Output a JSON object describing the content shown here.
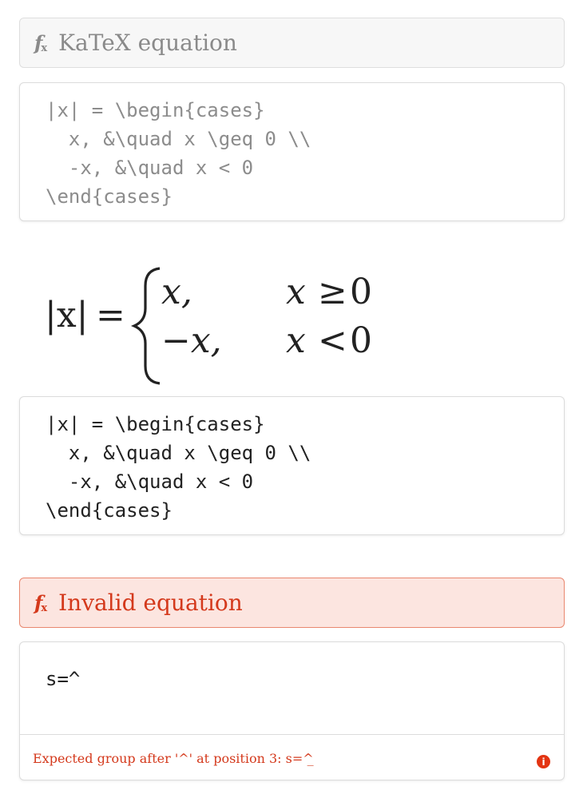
{
  "equation_block": {
    "icon": "fx-icon",
    "title": "KaTeX equation"
  },
  "source_editor": {
    "code": "|x| = \\begin{cases}\n  x, &\\quad x \\geq 0 \\\\\n  -x, &\\quad x < 0\n\\end{cases}"
  },
  "rendered_equation": {
    "lhs": "|x|",
    "equals": "=",
    "case1_value": "x,",
    "case1_condition_var": "x",
    "case1_condition_op": "≥",
    "case1_condition_num": "0",
    "case2_value": "−x,",
    "case2_condition_var": "x",
    "case2_condition_op": "<",
    "case2_condition_num": "0"
  },
  "source_editor_2": {
    "code": "|x| = \\begin{cases}\n  x, &\\quad x \\geq 0 \\\\\n  -x, &\\quad x < 0\n\\end{cases}"
  },
  "invalid_block": {
    "icon": "fx-icon",
    "title": "Invalid equation",
    "code": "s=^",
    "error_prefix": "Expected group after '^' at position 3: s=^",
    "error_suffix": "̲",
    "error_icon": "info-icon",
    "error_color": "#d4391c"
  },
  "colors": {
    "neutral_bar_bg": "#f7f7f7",
    "error_bar_bg": "#fce5e0",
    "error_text": "#d4391c"
  }
}
